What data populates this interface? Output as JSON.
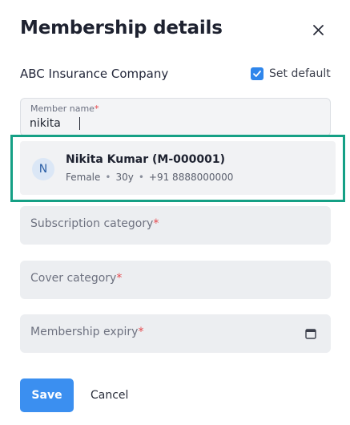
{
  "dialog": {
    "title": "Membership details",
    "close_icon": "close-icon"
  },
  "company": {
    "name": "ABC Insurance Company",
    "set_default_label": "Set default",
    "set_default_checked": true
  },
  "member_name": {
    "label": "Member name",
    "required_mark": "*",
    "value": "nikita"
  },
  "suggestion": {
    "avatar_initial": "N",
    "name": "Nikita Kumar (M-000001)",
    "gender": "Female",
    "age": "30y",
    "phone": "+91 8888000000",
    "separator": "•"
  },
  "fields": {
    "subscription_category": {
      "label": "Subscription category",
      "required_mark": "*"
    },
    "cover_category": {
      "label": "Cover category",
      "required_mark": "*"
    },
    "membership_expiry": {
      "label": "Membership expiry",
      "required_mark": "*",
      "icon": "calendar-icon"
    }
  },
  "actions": {
    "save_label": "Save",
    "cancel_label": "Cancel"
  },
  "colors": {
    "primary": "#3b8ff0",
    "checkbox": "#2f86eb",
    "highlight_border": "#15a085",
    "required": "#e5484d"
  }
}
